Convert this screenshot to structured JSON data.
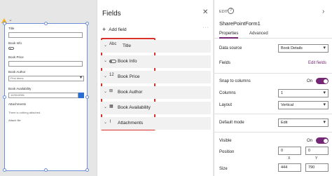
{
  "canvas": {
    "title_label": "Title",
    "book_info_label": "Book Info",
    "book_price_label": "Book Price",
    "book_author_label": "Book Author",
    "book_author_value": "Find items",
    "book_availability_label": "Book Availability",
    "book_availability_value": "12/31/2001",
    "attachments_label": "Attachments",
    "attachments_note": "There is nothing attached.",
    "attach_file_label": "Attach file"
  },
  "fields_panel": {
    "title": "Fields",
    "add_field_label": "Add field",
    "more_label": "···",
    "items": [
      {
        "name": "Title",
        "icon": "text-icon"
      },
      {
        "name": "Book Info",
        "icon": "toggle-icon"
      },
      {
        "name": "Book Price",
        "icon": "number-icon"
      },
      {
        "name": "Book Author",
        "icon": "lookup-icon"
      },
      {
        "name": "Book Availability",
        "icon": "calendar-icon"
      },
      {
        "name": "Attachments",
        "icon": "paperclip-icon"
      }
    ],
    "highlight_color": "#d9302a"
  },
  "properties": {
    "edit_label": "EDIT",
    "form_name": "SharePointForm1",
    "tabs": [
      {
        "label": "Properties",
        "active": true
      },
      {
        "label": "Advanced",
        "active": false
      }
    ],
    "data_source_label": "Data source",
    "data_source_value": "Book Details",
    "fields_label": "Fields",
    "edit_fields_link": "Edit fields",
    "snap_label": "Snap to columns",
    "snap_state": "On",
    "columns_label": "Columns",
    "columns_value": "1",
    "layout_label": "Layout",
    "layout_value": "Vertical",
    "default_mode_label": "Default mode",
    "default_mode_value": "Edit",
    "visible_label": "Visible",
    "visible_state": "On",
    "position_label": "Position",
    "position_x": "0",
    "position_y": "0",
    "x_label": "X",
    "y_label": "Y",
    "size_label": "Size",
    "size_width": "444",
    "size_height": "790",
    "accent_color": "#742774"
  }
}
